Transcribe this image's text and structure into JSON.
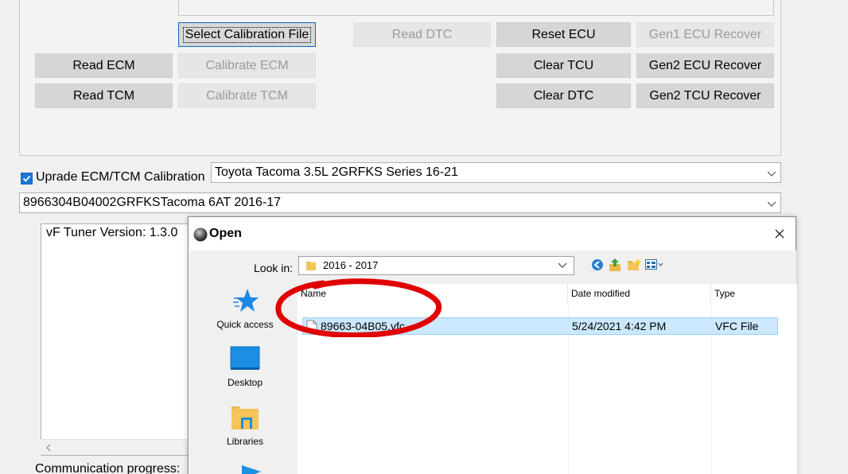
{
  "buttons": {
    "select_calibration_file": "Select Calibration File",
    "read_dtc": "Read DTC",
    "reset_ecu": "Reset ECU",
    "gen1_ecu_recover": "Gen1 ECU Recover",
    "read_ecm": "Read ECM",
    "calibrate_ecm": "Calibrate ECM",
    "clear_tcu": "Clear TCU",
    "gen2_ecu_recover": "Gen2 ECU Recover",
    "read_tcm": "Read TCM",
    "calibrate_tcm": "Calibrate TCM",
    "clear_dtc": "Clear DTC",
    "gen2_tcu_recover": "Gen2 TCU Recover"
  },
  "upgrade": {
    "label": "Uprade ECM/TCM Calibration",
    "checked": true,
    "vehicle_value": "Toyota Tacoma 3.5L 2GRFKS Series 16-21",
    "calibration_value": "8966304B04002GRFKSTacoma 6AT 2016-17"
  },
  "log": {
    "text": "vF Tuner Version: 1.3.0"
  },
  "status": {
    "comm_progress_label": "Communication progress:"
  },
  "dialog": {
    "title": "Open",
    "look_in_label": "Look in:",
    "look_in_value": "2016 - 2017",
    "places": [
      {
        "label": "Quick access",
        "icon": "quick-access-star-icon"
      },
      {
        "label": "Desktop",
        "icon": "desktop-icon"
      },
      {
        "label": "Libraries",
        "icon": "libraries-icon"
      }
    ],
    "columns": {
      "name": "Name",
      "date_modified": "Date modified",
      "type": "Type"
    },
    "files": [
      {
        "name": "89663-04B05.vfc",
        "date_modified": "5/24/2021 4:42 PM",
        "type": "VFC File",
        "selected": true
      }
    ]
  },
  "colors": {
    "accent": "#1976d2",
    "selection": "#cce8ff",
    "annotation": "#e00000"
  }
}
